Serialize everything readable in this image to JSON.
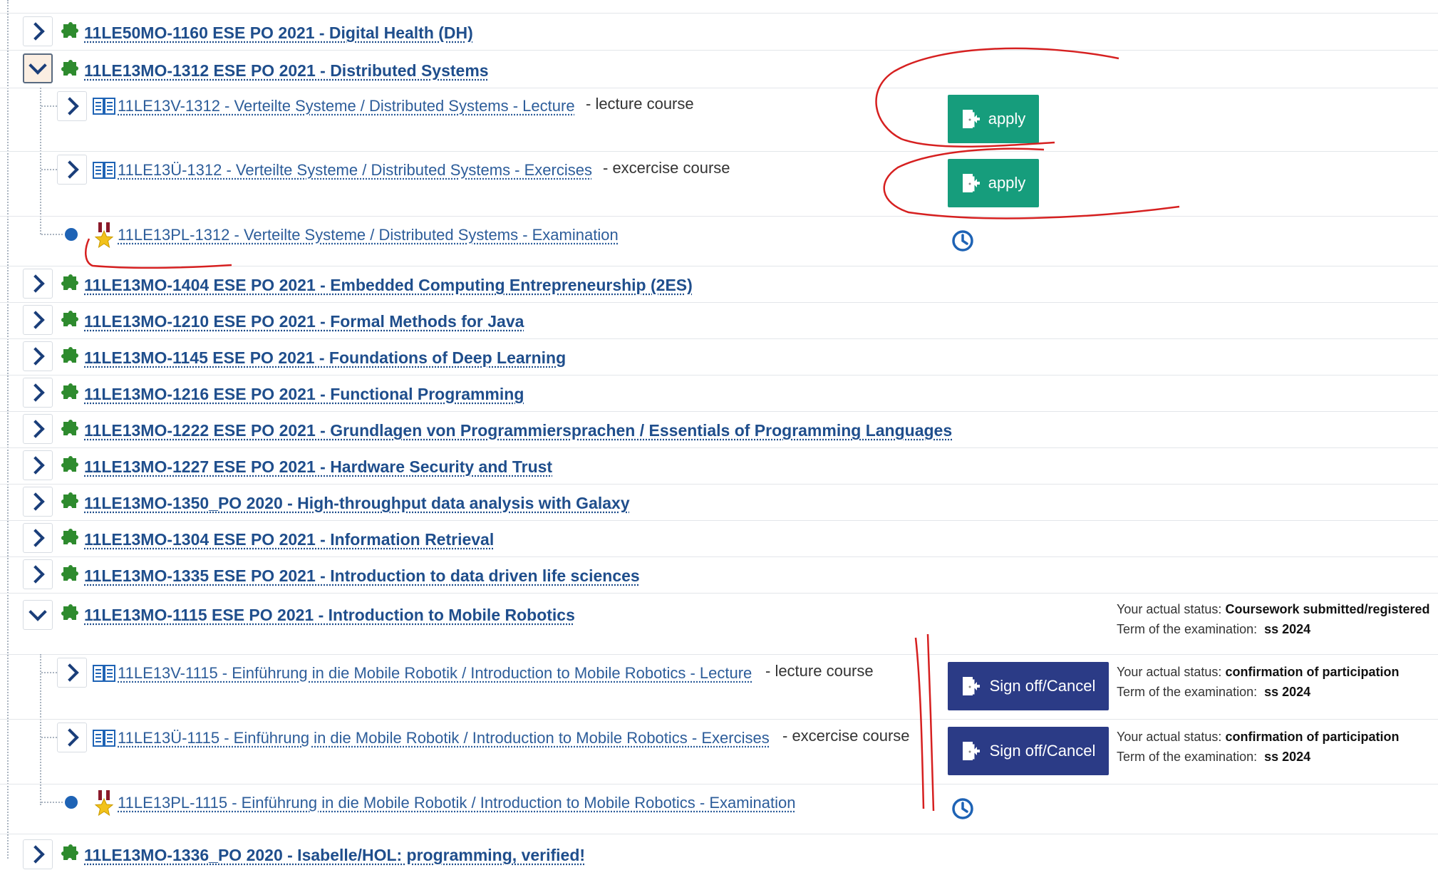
{
  "modules": [
    {
      "code_title": "11LE50MO-1160 ESE PO 2021 - Digital Health (DH)",
      "expanded": false
    },
    {
      "code_title": "11LE13MO-1312 ESE PO 2021 - Distributed Systems",
      "expanded": true
    },
    {
      "code_title": "11LE13MO-1404 ESE PO 2021 - Embedded Computing Entrepreneurship (2ES)",
      "expanded": false
    },
    {
      "code_title": "11LE13MO-1210 ESE PO 2021 - Formal Methods for Java",
      "expanded": false
    },
    {
      "code_title": "11LE13MO-1145 ESE PO 2021 - Foundations of Deep Learning",
      "expanded": false
    },
    {
      "code_title": "11LE13MO-1216 ESE PO 2021 - Functional Programming",
      "expanded": false
    },
    {
      "code_title": "11LE13MO-1222 ESE PO 2021 - Grundlagen von Programmiersprachen / Essentials of Programming Languages",
      "expanded": false
    },
    {
      "code_title": "11LE13MO-1227 ESE PO 2021 - Hardware Security and Trust",
      "expanded": false
    },
    {
      "code_title": "11LE13MO-1350_PO 2020 - High-throughput data analysis with Galaxy",
      "expanded": false
    },
    {
      "code_title": "11LE13MO-1304 ESE PO 2021 - Information Retrieval",
      "expanded": false
    },
    {
      "code_title": "11LE13MO-1335 ESE PO 2021 - Introduction to data driven life sciences",
      "expanded": false
    },
    {
      "code_title": "11LE13MO-1115 ESE PO 2021 - Introduction to Mobile Robotics",
      "expanded": true
    },
    {
      "code_title": "11LE13MO-1336_PO 2020 - Isabelle/HOL: programming, verified!",
      "expanded": false
    }
  ],
  "distributed_systems": {
    "lecture": {
      "title": "11LE13V-1312 - Verteilte Systeme / Distributed Systems - Lecture",
      "type": "- lecture course",
      "button": "apply"
    },
    "exercises": {
      "title": "11LE13Ü-1312 - Verteilte Systeme / Distributed Systems - Exercises",
      "type": "- excercise course",
      "button": "apply"
    },
    "exam": {
      "title": "11LE13PL-1312 - Verteilte Systeme / Distributed Systems - Examination"
    }
  },
  "mobile_robotics": {
    "status_label": "Your actual status:",
    "term_label": "Term of the examination:",
    "module_status": "Coursework submitted/registered",
    "module_term": "ss 2024",
    "lecture": {
      "title": "11LE13V-1115 - Einführung in die Mobile Robotik / Introduction to Mobile Robotics - Lecture",
      "type": "- lecture course",
      "button": "Sign off/Cancel",
      "status": "confirmation of participation",
      "term": "ss 2024"
    },
    "exercises": {
      "title": "11LE13Ü-1115 - Einführung in die Mobile Robotik / Introduction to Mobile Robotics - Exercises",
      "type": "- excercise course",
      "button": "Sign off/Cancel",
      "status": "confirmation of participation",
      "term": "ss 2024"
    },
    "exam": {
      "title": "11LE13PL-1115 - Einführung in die Mobile Robotik / Introduction to Mobile Robotics - Examination"
    }
  },
  "colors": {
    "link": "#1f4e8c",
    "apply_button": "#169d7c",
    "signoff_button": "#2b3b86",
    "puzzle_icon": "#2e8b2e",
    "annotation": "#d62020"
  }
}
